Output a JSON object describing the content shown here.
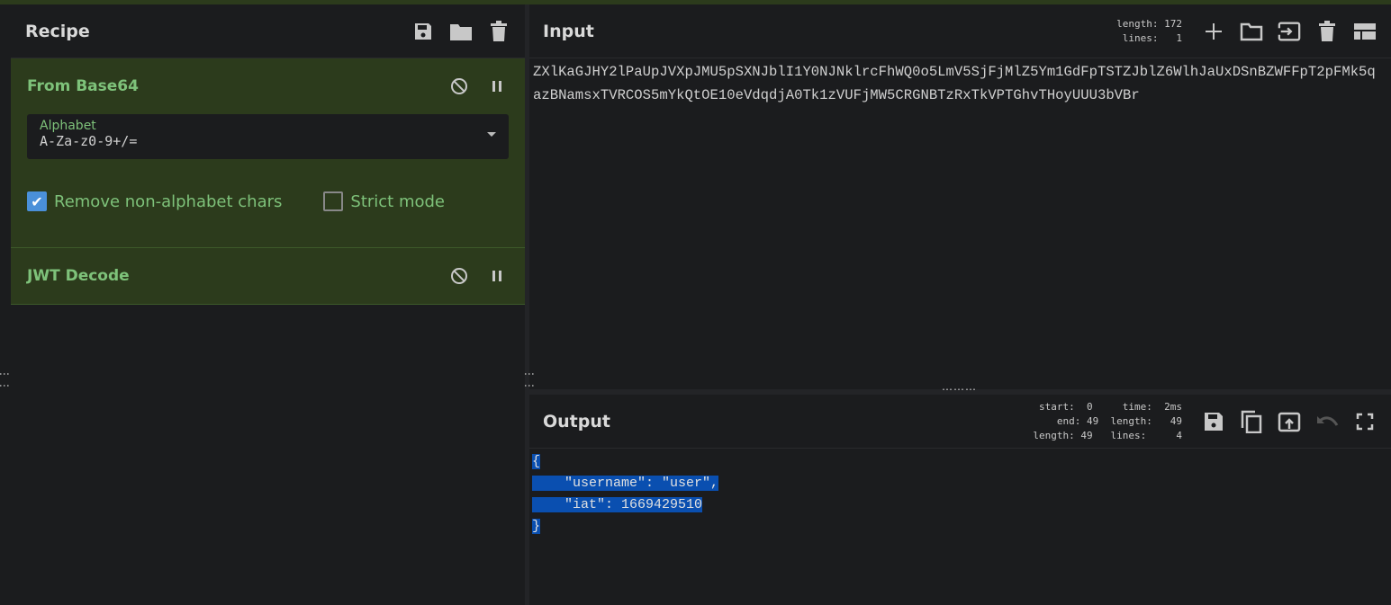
{
  "recipe": {
    "title": "Recipe",
    "icons": [
      "save-icon",
      "folder-icon",
      "trash-icon"
    ],
    "operations": [
      {
        "name": "From Base64",
        "alphabet_label": "Alphabet",
        "alphabet_value": "A-Za-z0-9+/=",
        "options": [
          {
            "label": "Remove non-alphabet chars",
            "checked": true
          },
          {
            "label": "Strict mode",
            "checked": false
          }
        ]
      },
      {
        "name": "JWT Decode"
      }
    ]
  },
  "input": {
    "title": "Input",
    "length_label": "length:",
    "length": "172",
    "lines_label": "lines:",
    "lines": "1",
    "text": "ZXlKaGJHY2lPaUpJVXpJMU5pSXNJblI1Y0NJNklrcFhWQ0o5LmV5SjFjMlZ5Ym1GdFpTSTZJblZ6WlhJaUxDSnBZWFFpT2pFMk5qazBNamsxTVRCOS5mYkQtOE10eVdqdjA0Tk1zVUFjMW5CRGNBTzRxTkVPTGhvTHoyUUU3bVBr"
  },
  "output": {
    "title": "Output",
    "start": "0",
    "end": "49",
    "sel_length": "49",
    "time": "2ms",
    "length": "49",
    "lines": "4",
    "lines_text": [
      "{",
      "    \"username\": \"user\",",
      "    \"iat\": 1669429510",
      "}"
    ]
  },
  "colors": {
    "accent": "#7ec27a",
    "op_bg": "#2c3b1c",
    "selection": "#0a4fb0"
  }
}
